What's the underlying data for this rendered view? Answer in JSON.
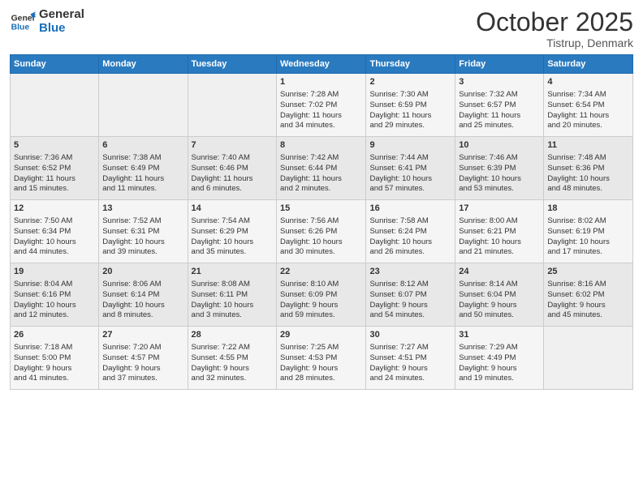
{
  "header": {
    "logo_line1": "General",
    "logo_line2": "Blue",
    "month": "October 2025",
    "location": "Tistrup, Denmark"
  },
  "days_of_week": [
    "Sunday",
    "Monday",
    "Tuesday",
    "Wednesday",
    "Thursday",
    "Friday",
    "Saturday"
  ],
  "weeks": [
    [
      {
        "day": "",
        "text": ""
      },
      {
        "day": "",
        "text": ""
      },
      {
        "day": "",
        "text": ""
      },
      {
        "day": "1",
        "text": "Sunrise: 7:28 AM\nSunset: 7:02 PM\nDaylight: 11 hours\nand 34 minutes."
      },
      {
        "day": "2",
        "text": "Sunrise: 7:30 AM\nSunset: 6:59 PM\nDaylight: 11 hours\nand 29 minutes."
      },
      {
        "day": "3",
        "text": "Sunrise: 7:32 AM\nSunset: 6:57 PM\nDaylight: 11 hours\nand 25 minutes."
      },
      {
        "day": "4",
        "text": "Sunrise: 7:34 AM\nSunset: 6:54 PM\nDaylight: 11 hours\nand 20 minutes."
      }
    ],
    [
      {
        "day": "5",
        "text": "Sunrise: 7:36 AM\nSunset: 6:52 PM\nDaylight: 11 hours\nand 15 minutes."
      },
      {
        "day": "6",
        "text": "Sunrise: 7:38 AM\nSunset: 6:49 PM\nDaylight: 11 hours\nand 11 minutes."
      },
      {
        "day": "7",
        "text": "Sunrise: 7:40 AM\nSunset: 6:46 PM\nDaylight: 11 hours\nand 6 minutes."
      },
      {
        "day": "8",
        "text": "Sunrise: 7:42 AM\nSunset: 6:44 PM\nDaylight: 11 hours\nand 2 minutes."
      },
      {
        "day": "9",
        "text": "Sunrise: 7:44 AM\nSunset: 6:41 PM\nDaylight: 10 hours\nand 57 minutes."
      },
      {
        "day": "10",
        "text": "Sunrise: 7:46 AM\nSunset: 6:39 PM\nDaylight: 10 hours\nand 53 minutes."
      },
      {
        "day": "11",
        "text": "Sunrise: 7:48 AM\nSunset: 6:36 PM\nDaylight: 10 hours\nand 48 minutes."
      }
    ],
    [
      {
        "day": "12",
        "text": "Sunrise: 7:50 AM\nSunset: 6:34 PM\nDaylight: 10 hours\nand 44 minutes."
      },
      {
        "day": "13",
        "text": "Sunrise: 7:52 AM\nSunset: 6:31 PM\nDaylight: 10 hours\nand 39 minutes."
      },
      {
        "day": "14",
        "text": "Sunrise: 7:54 AM\nSunset: 6:29 PM\nDaylight: 10 hours\nand 35 minutes."
      },
      {
        "day": "15",
        "text": "Sunrise: 7:56 AM\nSunset: 6:26 PM\nDaylight: 10 hours\nand 30 minutes."
      },
      {
        "day": "16",
        "text": "Sunrise: 7:58 AM\nSunset: 6:24 PM\nDaylight: 10 hours\nand 26 minutes."
      },
      {
        "day": "17",
        "text": "Sunrise: 8:00 AM\nSunset: 6:21 PM\nDaylight: 10 hours\nand 21 minutes."
      },
      {
        "day": "18",
        "text": "Sunrise: 8:02 AM\nSunset: 6:19 PM\nDaylight: 10 hours\nand 17 minutes."
      }
    ],
    [
      {
        "day": "19",
        "text": "Sunrise: 8:04 AM\nSunset: 6:16 PM\nDaylight: 10 hours\nand 12 minutes."
      },
      {
        "day": "20",
        "text": "Sunrise: 8:06 AM\nSunset: 6:14 PM\nDaylight: 10 hours\nand 8 minutes."
      },
      {
        "day": "21",
        "text": "Sunrise: 8:08 AM\nSunset: 6:11 PM\nDaylight: 10 hours\nand 3 minutes."
      },
      {
        "day": "22",
        "text": "Sunrise: 8:10 AM\nSunset: 6:09 PM\nDaylight: 9 hours\nand 59 minutes."
      },
      {
        "day": "23",
        "text": "Sunrise: 8:12 AM\nSunset: 6:07 PM\nDaylight: 9 hours\nand 54 minutes."
      },
      {
        "day": "24",
        "text": "Sunrise: 8:14 AM\nSunset: 6:04 PM\nDaylight: 9 hours\nand 50 minutes."
      },
      {
        "day": "25",
        "text": "Sunrise: 8:16 AM\nSunset: 6:02 PM\nDaylight: 9 hours\nand 45 minutes."
      }
    ],
    [
      {
        "day": "26",
        "text": "Sunrise: 7:18 AM\nSunset: 5:00 PM\nDaylight: 9 hours\nand 41 minutes."
      },
      {
        "day": "27",
        "text": "Sunrise: 7:20 AM\nSunset: 4:57 PM\nDaylight: 9 hours\nand 37 minutes."
      },
      {
        "day": "28",
        "text": "Sunrise: 7:22 AM\nSunset: 4:55 PM\nDaylight: 9 hours\nand 32 minutes."
      },
      {
        "day": "29",
        "text": "Sunrise: 7:25 AM\nSunset: 4:53 PM\nDaylight: 9 hours\nand 28 minutes."
      },
      {
        "day": "30",
        "text": "Sunrise: 7:27 AM\nSunset: 4:51 PM\nDaylight: 9 hours\nand 24 minutes."
      },
      {
        "day": "31",
        "text": "Sunrise: 7:29 AM\nSunset: 4:49 PM\nDaylight: 9 hours\nand 19 minutes."
      },
      {
        "day": "",
        "text": ""
      }
    ]
  ]
}
